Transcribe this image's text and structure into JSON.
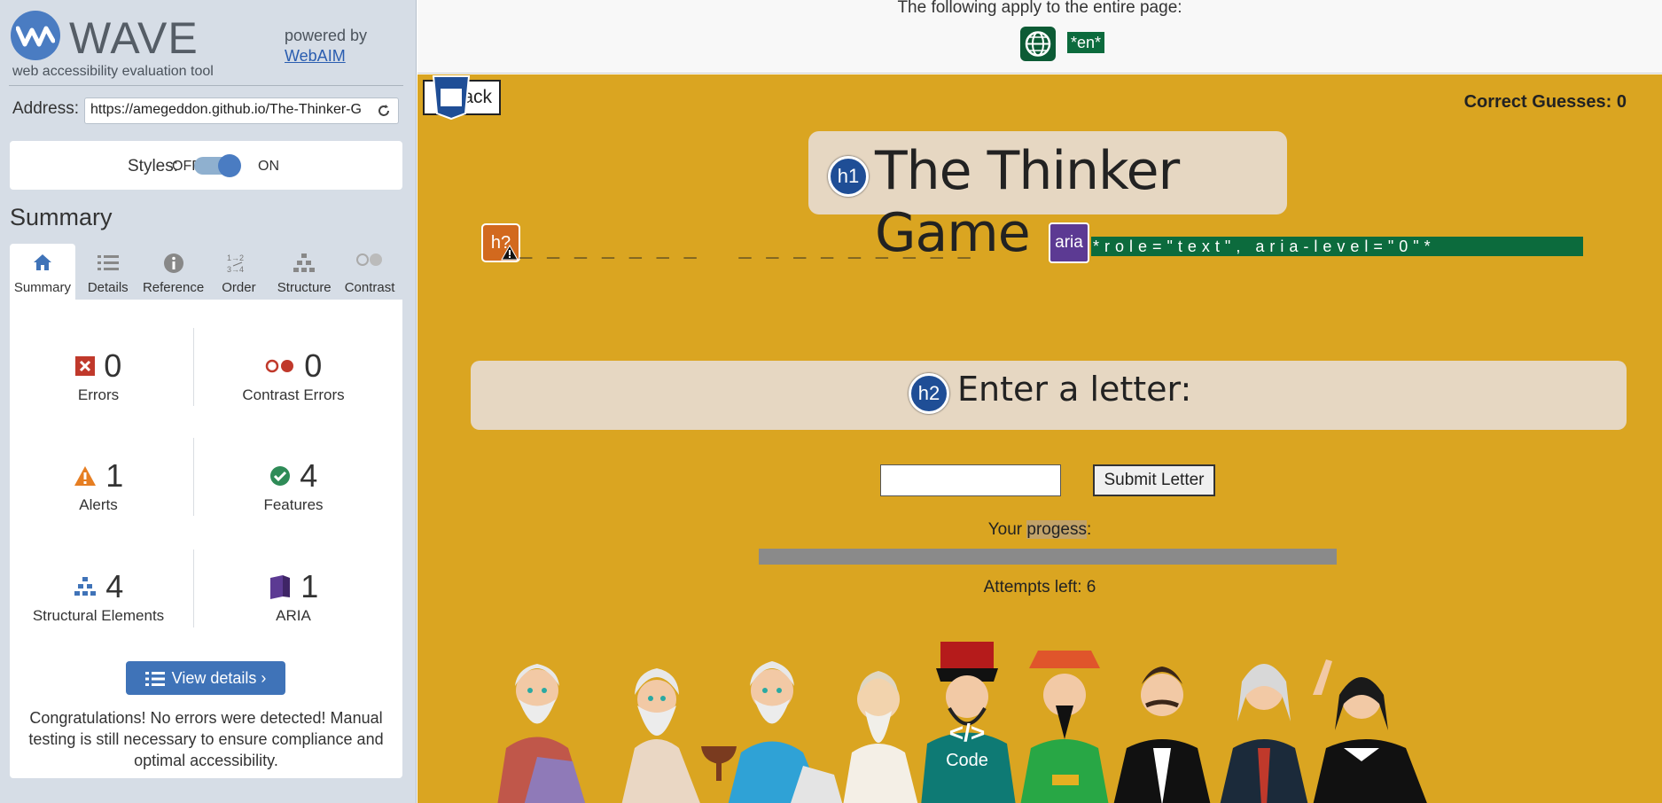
{
  "wave": {
    "wordmark": "WAVE",
    "tagline": "web accessibility evaluation tool",
    "powered_by": "powered by",
    "webaim": "WebAIM",
    "address_label": "Address:",
    "address_value": "https://amegeddon.github.io/The-Thinker-G",
    "styles_label": "Styles:",
    "styles_off": "OFF",
    "styles_on": "ON",
    "styles_enabled": true,
    "summary_heading": "Summary",
    "tabs": [
      {
        "label": "Summary",
        "icon": "home-icon",
        "active": true
      },
      {
        "label": "Details",
        "icon": "list-icon",
        "active": false
      },
      {
        "label": "Reference",
        "icon": "info-icon",
        "active": false
      },
      {
        "label": "Order",
        "icon": "order-icon",
        "active": false
      },
      {
        "label": "Structure",
        "icon": "structure-icon",
        "active": false
      },
      {
        "label": "Contrast",
        "icon": "contrast-icon",
        "active": false
      }
    ],
    "stats": {
      "errors": {
        "count": "0",
        "label": "Errors"
      },
      "contrast_errors": {
        "count": "0",
        "label": "Contrast Errors"
      },
      "alerts": {
        "count": "1",
        "label": "Alerts"
      },
      "features": {
        "count": "4",
        "label": "Features"
      },
      "structural": {
        "count": "4",
        "label": "Structural Elements"
      },
      "aria": {
        "count": "1",
        "label": "ARIA"
      }
    },
    "view_details": "View details ›",
    "congrats": "Congratulations! No errors were detected! Manual testing is still necessary to ensure compliance and optimal accessibility.",
    "colors": {
      "panel_bg": "#d6dde6",
      "accent": "#3f73b8",
      "error": "#c0392b",
      "alert": "#e67e22",
      "feature": "#2e8b57",
      "aria": "#5c3a93"
    }
  },
  "page": {
    "top_text": "The following apply to the entire page:",
    "lang_badge": "*en*",
    "back_button": "Back",
    "correct_guesses": "Correct Guesses: 0",
    "title": "The Thinker Game",
    "h1_badge": "h1",
    "h2_badge": "h2",
    "hq_badge": "h?",
    "word_blanks": "_ _ _ _ _ _ _   _ _ _ _ _ _ _ _ _",
    "aria_badge": "aria",
    "aria_text": "*role=\"text\", aria-level=\"0\"*",
    "letter_label": "Enter a letter:",
    "submit_letter": "Submit Letter",
    "progress_prefix": "Your ",
    "progress_word": "progess",
    "progress_suffix": ":",
    "progress_value": 0,
    "attempts": "Attempts left: 6",
    "code_badge_glyph": "</>",
    "code_badge_label": "Code",
    "colors": {
      "game_bg": "#daa521",
      "box_bg": "#e6d7c2",
      "lang_green": "#0c6b3d"
    }
  }
}
